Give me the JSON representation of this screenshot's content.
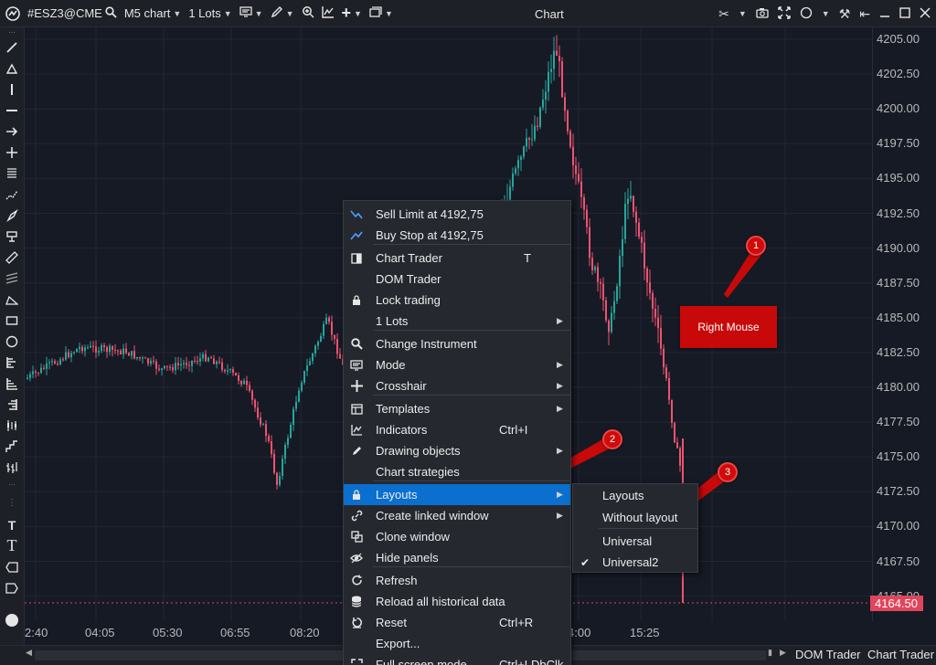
{
  "toolbar": {
    "symbol": "#ESZ3@CME",
    "chart_type": "M5 chart",
    "lots": "1 Lots"
  },
  "window": {
    "title": "Chart"
  },
  "y_axis": {
    "labels": [
      "4205.00",
      "4202.50",
      "4200.00",
      "4197.50",
      "4195.00",
      "4192.50",
      "4190.00",
      "4187.50",
      "4185.00",
      "4182.50",
      "4180.00",
      "4177.50",
      "4175.00",
      "4172.50",
      "4170.00",
      "4167.50",
      "4165.00"
    ],
    "last_price": "4164.50"
  },
  "x_axis": {
    "labels": [
      "2:40",
      "04:05",
      "05:30",
      "06:55",
      "08:20",
      "4:00",
      "15:25"
    ]
  },
  "context_menu": {
    "items": [
      {
        "label": "Sell Limit at 4192,75",
        "shortcut": "",
        "icon": "sell-limit-icon"
      },
      {
        "label": "Buy Stop at 4192,75",
        "shortcut": "",
        "icon": "buy-stop-icon"
      },
      {
        "label": "Chart Trader",
        "shortcut": "T",
        "icon": "chart-trader-icon"
      },
      {
        "label": "DOM Trader",
        "shortcut": "",
        "icon": ""
      },
      {
        "label": "Lock trading",
        "shortcut": "",
        "icon": "lock-icon"
      },
      {
        "label": "1 Lots",
        "shortcut": "",
        "icon": ""
      },
      {
        "label": "Change Instrument",
        "shortcut": "",
        "icon": "search-icon"
      },
      {
        "label": "Mode",
        "shortcut": "",
        "icon": "mode-icon"
      },
      {
        "label": "Crosshair",
        "shortcut": "",
        "icon": "crosshair-icon"
      },
      {
        "label": "Templates",
        "shortcut": "",
        "icon": "templates-icon"
      },
      {
        "label": "Indicators",
        "shortcut": "Ctrl+I",
        "icon": "indicators-icon"
      },
      {
        "label": "Drawing objects",
        "shortcut": "",
        "icon": "pencil-icon"
      },
      {
        "label": "Chart strategies",
        "shortcut": "",
        "icon": ""
      },
      {
        "label": "Layouts",
        "shortcut": "",
        "icon": "lock-icon"
      },
      {
        "label": "Create linked window",
        "shortcut": "",
        "icon": "link-icon"
      },
      {
        "label": "Clone window",
        "shortcut": "",
        "icon": "clone-icon"
      },
      {
        "label": "Hide panels",
        "shortcut": "",
        "icon": "eye-icon"
      },
      {
        "label": "Refresh",
        "shortcut": "",
        "icon": "refresh-icon"
      },
      {
        "label": "Reload all historical data",
        "shortcut": "",
        "icon": "database-icon"
      },
      {
        "label": "Reset",
        "shortcut": "Ctrl+R",
        "icon": "reset-icon"
      },
      {
        "label": "Export...",
        "shortcut": "",
        "icon": ""
      },
      {
        "label": "Full screen mode",
        "shortcut": "Ctrl+LDbClk",
        "icon": "fullscreen-icon"
      }
    ]
  },
  "submenu": {
    "items": [
      {
        "label": "Layouts",
        "checked": false
      },
      {
        "label": "Without layout",
        "checked": false
      },
      {
        "label": "Universal",
        "checked": false
      },
      {
        "label": "Universal2",
        "checked": true
      }
    ]
  },
  "annotations": {
    "step1": "1",
    "step2": "2",
    "step3": "3",
    "right_mouse_label": "Right Mouse"
  },
  "bottom_bar": {
    "dom_trader": "DOM Trader",
    "chart_trader": "Chart Trader"
  },
  "colors": {
    "up": "#26a69a",
    "down": "#ef5370",
    "menu_highlight": "#0a6fcf",
    "annotation": "#c70909"
  }
}
